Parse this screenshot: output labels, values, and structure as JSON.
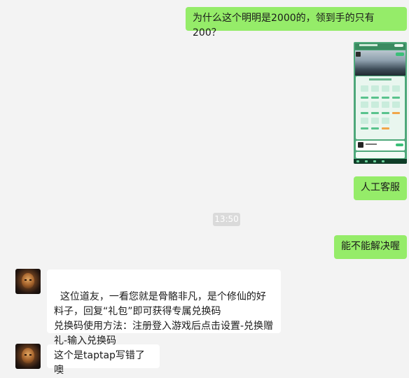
{
  "messages": {
    "m1": "为什么这个明明是2000的，领到手的只有200？",
    "m3": "人工客服",
    "time": "13:50",
    "m4": "能不能解决喔",
    "m5": "这位道友，一看您就是骨骼非凡，是个修仙的好料子，回复“礼包”即可获得专属兑换码\n兑换码使用方法：注册登入游戏后点击设置-兑换赠礼-输入兑换码",
    "m6": "这个是taptap写错了噢"
  },
  "colors": {
    "background": "#f3f3f3",
    "outgoing_bubble": "#95ec69",
    "incoming_bubble": "#ffffff",
    "time_pill": "#dadada"
  }
}
